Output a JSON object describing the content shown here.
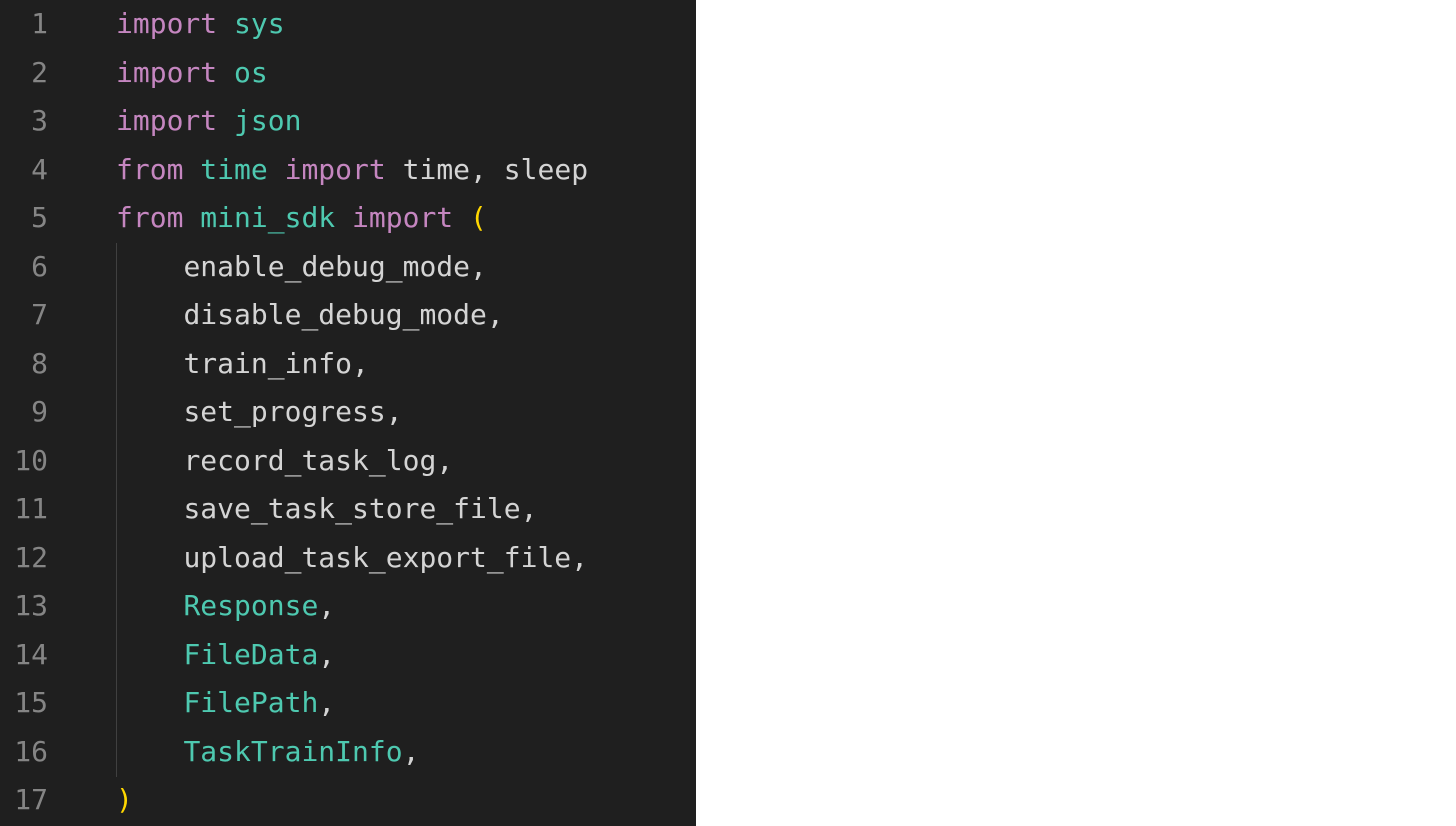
{
  "editor": {
    "lines": [
      {
        "num": "1",
        "tokens": [
          {
            "t": "kw",
            "v": "import"
          },
          {
            "t": "sp",
            "v": " "
          },
          {
            "t": "mod",
            "v": "sys"
          }
        ]
      },
      {
        "num": "2",
        "tokens": [
          {
            "t": "kw",
            "v": "import"
          },
          {
            "t": "sp",
            "v": " "
          },
          {
            "t": "mod",
            "v": "os"
          }
        ]
      },
      {
        "num": "3",
        "tokens": [
          {
            "t": "kw",
            "v": "import"
          },
          {
            "t": "sp",
            "v": " "
          },
          {
            "t": "mod",
            "v": "json"
          }
        ]
      },
      {
        "num": "4",
        "tokens": [
          {
            "t": "kw",
            "v": "from"
          },
          {
            "t": "sp",
            "v": " "
          },
          {
            "t": "mod",
            "v": "time"
          },
          {
            "t": "sp",
            "v": " "
          },
          {
            "t": "kw",
            "v": "import"
          },
          {
            "t": "sp",
            "v": " "
          },
          {
            "t": "id",
            "v": "time"
          },
          {
            "t": "punc",
            "v": ", "
          },
          {
            "t": "id",
            "v": "sleep"
          }
        ]
      },
      {
        "num": "5",
        "tokens": [
          {
            "t": "kw",
            "v": "from"
          },
          {
            "t": "sp",
            "v": " "
          },
          {
            "t": "mod",
            "v": "mini_sdk"
          },
          {
            "t": "sp",
            "v": " "
          },
          {
            "t": "kw",
            "v": "import"
          },
          {
            "t": "sp",
            "v": " "
          },
          {
            "t": "paren",
            "v": "("
          }
        ]
      },
      {
        "num": "6",
        "tokens": [
          {
            "t": "sp",
            "v": "    "
          },
          {
            "t": "id",
            "v": "enable_debug_mode"
          },
          {
            "t": "punc",
            "v": ","
          }
        ]
      },
      {
        "num": "7",
        "tokens": [
          {
            "t": "sp",
            "v": "    "
          },
          {
            "t": "id",
            "v": "disable_debug_mode"
          },
          {
            "t": "punc",
            "v": ","
          }
        ]
      },
      {
        "num": "8",
        "tokens": [
          {
            "t": "sp",
            "v": "    "
          },
          {
            "t": "id",
            "v": "train_info"
          },
          {
            "t": "punc",
            "v": ","
          }
        ]
      },
      {
        "num": "9",
        "tokens": [
          {
            "t": "sp",
            "v": "    "
          },
          {
            "t": "id",
            "v": "set_progress"
          },
          {
            "t": "punc",
            "v": ","
          }
        ]
      },
      {
        "num": "10",
        "tokens": [
          {
            "t": "sp",
            "v": "    "
          },
          {
            "t": "id",
            "v": "record_task_log"
          },
          {
            "t": "punc",
            "v": ","
          }
        ]
      },
      {
        "num": "11",
        "tokens": [
          {
            "t": "sp",
            "v": "    "
          },
          {
            "t": "id",
            "v": "save_task_store_file"
          },
          {
            "t": "punc",
            "v": ","
          }
        ]
      },
      {
        "num": "12",
        "tokens": [
          {
            "t": "sp",
            "v": "    "
          },
          {
            "t": "id",
            "v": "upload_task_export_file"
          },
          {
            "t": "punc",
            "v": ","
          }
        ]
      },
      {
        "num": "13",
        "tokens": [
          {
            "t": "sp",
            "v": "    "
          },
          {
            "t": "cls",
            "v": "Response"
          },
          {
            "t": "punc",
            "v": ","
          }
        ]
      },
      {
        "num": "14",
        "tokens": [
          {
            "t": "sp",
            "v": "    "
          },
          {
            "t": "cls",
            "v": "FileData"
          },
          {
            "t": "punc",
            "v": ","
          }
        ]
      },
      {
        "num": "15",
        "tokens": [
          {
            "t": "sp",
            "v": "    "
          },
          {
            "t": "cls",
            "v": "FilePath"
          },
          {
            "t": "punc",
            "v": ","
          }
        ]
      },
      {
        "num": "16",
        "tokens": [
          {
            "t": "sp",
            "v": "    "
          },
          {
            "t": "cls",
            "v": "TaskTrainInfo"
          },
          {
            "t": "punc",
            "v": ","
          }
        ]
      },
      {
        "num": "17",
        "tokens": [
          {
            "t": "paren",
            "v": ")"
          }
        ]
      }
    ],
    "colors": {
      "background": "#1f1f1f",
      "line_number": "#858585",
      "keyword": "#c586c0",
      "module": "#4ec9b0",
      "identifier": "#d4d4d4",
      "class_name": "#4ec9b0",
      "bracket": "#ffd700",
      "page_background": "#ffffff"
    }
  }
}
